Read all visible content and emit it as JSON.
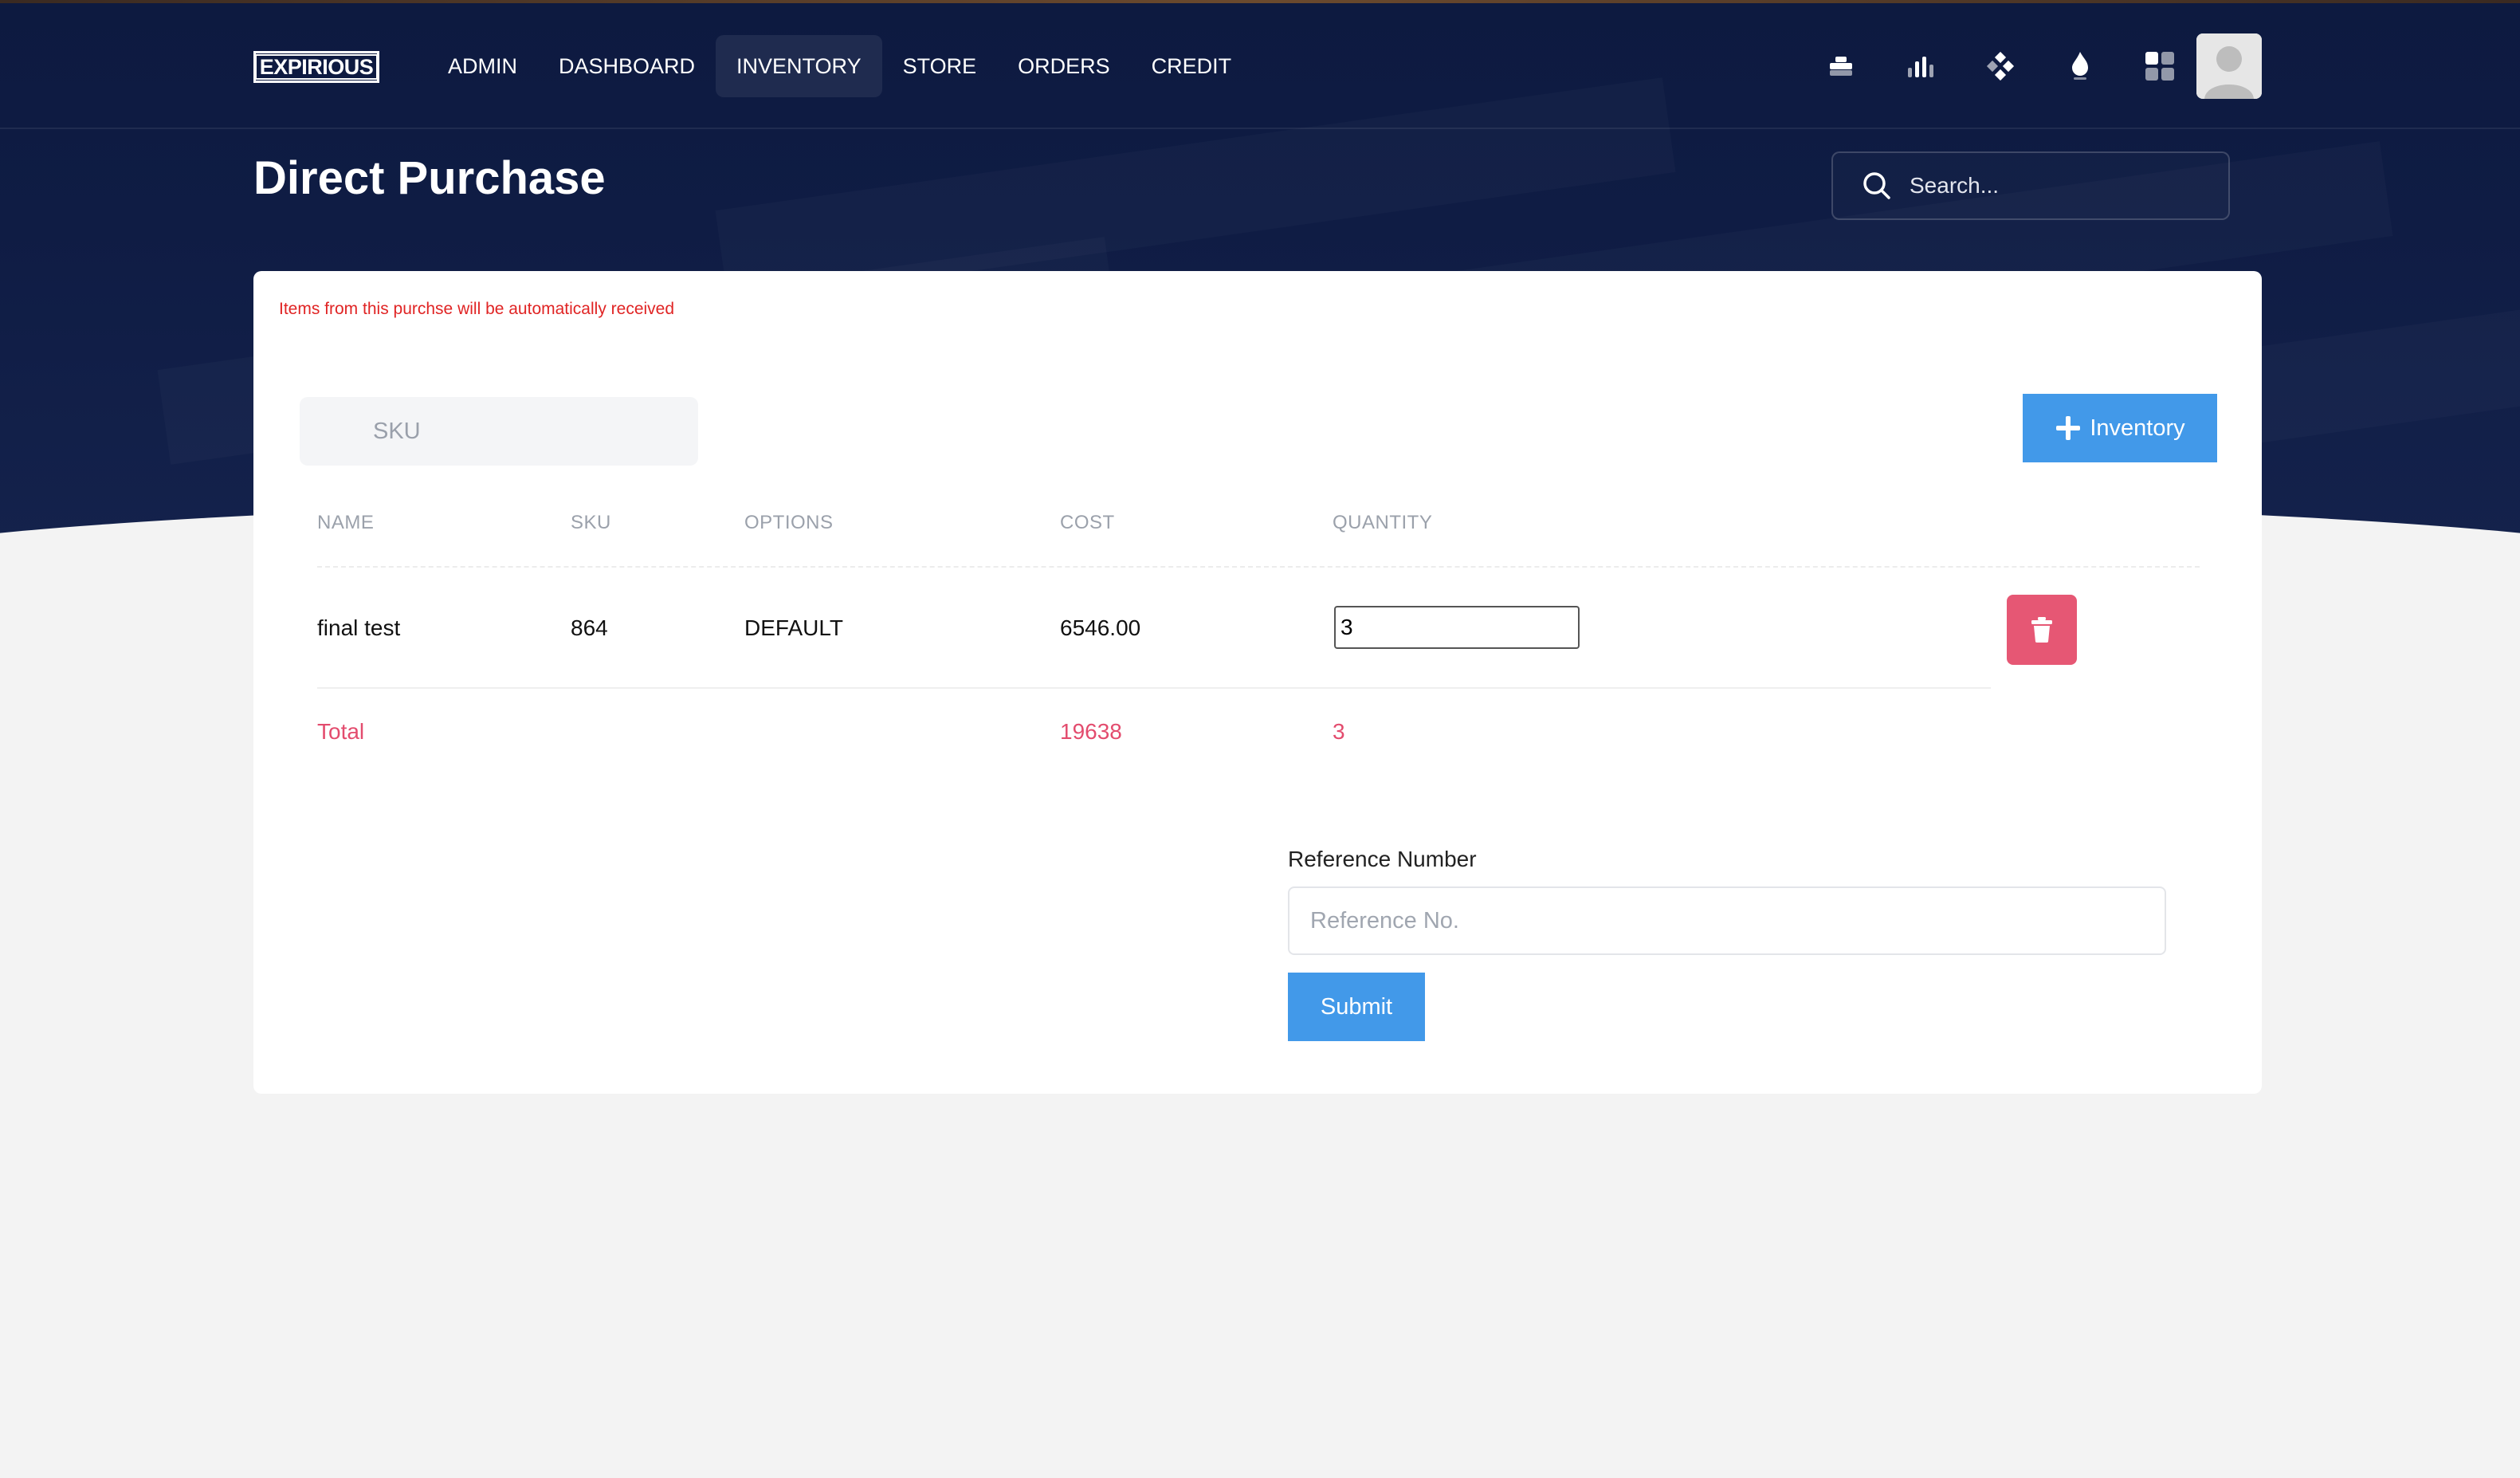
{
  "brand": {
    "logo_text": "EXPIRIOUS"
  },
  "nav": {
    "items": [
      {
        "label": "ADMIN",
        "active": false
      },
      {
        "label": "DASHBOARD",
        "active": false
      },
      {
        "label": "INVENTORY",
        "active": true
      },
      {
        "label": "STORE",
        "active": false
      },
      {
        "label": "ORDERS",
        "active": false
      },
      {
        "label": "CREDIT",
        "active": false
      }
    ],
    "icons": [
      "toolbox-icon",
      "bar-chart-icon",
      "diamond-grid-icon",
      "flame-icon",
      "apps-grid-icon"
    ]
  },
  "page": {
    "title": "Direct Purchase"
  },
  "search": {
    "placeholder": "Search..."
  },
  "card": {
    "notice": "Items from this purchse will be automatically received",
    "sku_placeholder": "SKU",
    "add_inventory_label": "Inventory"
  },
  "table": {
    "headers": [
      "NAME",
      "SKU",
      "OPTIONS",
      "COST",
      "QUANTITY"
    ],
    "rows": [
      {
        "name": "final test",
        "sku": "864",
        "options": "DEFAULT",
        "cost": "6546.00",
        "quantity": "3"
      }
    ],
    "total": {
      "label": "Total",
      "cost": "19638",
      "quantity": "3"
    }
  },
  "reference": {
    "label": "Reference Number",
    "placeholder": "Reference No.",
    "submit_label": "Submit"
  },
  "colors": {
    "header_bg": "#0f1c44",
    "accent_blue": "#4299e9",
    "danger_pink": "#e65774",
    "notice_red": "#e02424",
    "total_pink": "#e34c6e"
  }
}
